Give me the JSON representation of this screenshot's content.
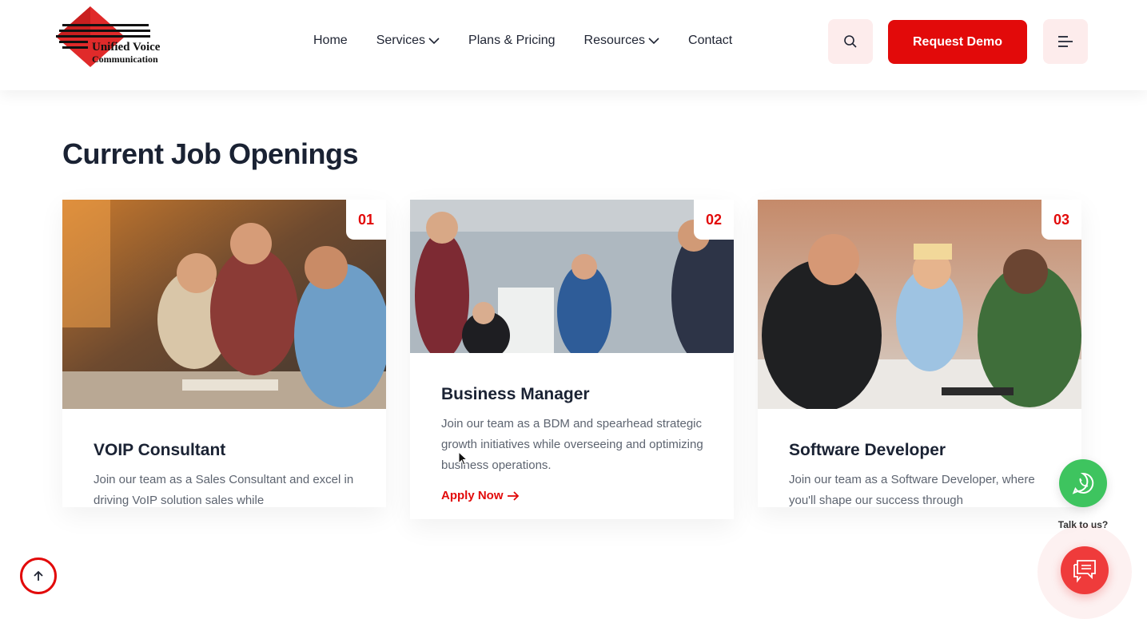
{
  "brand": {
    "name_line1": "Unified Voice",
    "name_line2": "Communication"
  },
  "nav": {
    "items": [
      {
        "label": "Home",
        "has_dropdown": false
      },
      {
        "label": "Services",
        "has_dropdown": true
      },
      {
        "label": "Plans & Pricing",
        "has_dropdown": false
      },
      {
        "label": "Resources",
        "has_dropdown": true
      },
      {
        "label": "Contact",
        "has_dropdown": false
      }
    ]
  },
  "header": {
    "search_icon": "search-icon",
    "demo_label": "Request Demo",
    "menu_icon": "hamburger-menu-icon"
  },
  "section": {
    "title": "Current Job Openings"
  },
  "jobs": [
    {
      "num": "01",
      "title": "VOIP Consultant",
      "desc": "Join our team as a Sales Consultant and excel in driving VoIP solution sales while"
    },
    {
      "num": "02",
      "title": "Business Manager",
      "desc": "Join our team as a BDM and spearhead strategic growth initiatives while overseeing and optimizing business operations.",
      "apply": "Apply Now"
    },
    {
      "num": "03",
      "title": "Software Developer",
      "desc": "Join our team as a Software Developer, where you'll shape our success through"
    }
  ],
  "floating": {
    "talk_label": "Talk to us?",
    "whatsapp_icon": "whatsapp-icon",
    "chat_icon": "chat-icon",
    "back_to_top_icon": "arrow-up-icon"
  },
  "colors": {
    "accent": "#e20a0a",
    "accent_soft": "#fdecec",
    "whatsapp": "#3ec45f",
    "heading": "#1a2233",
    "body_text": "#5d6470"
  }
}
